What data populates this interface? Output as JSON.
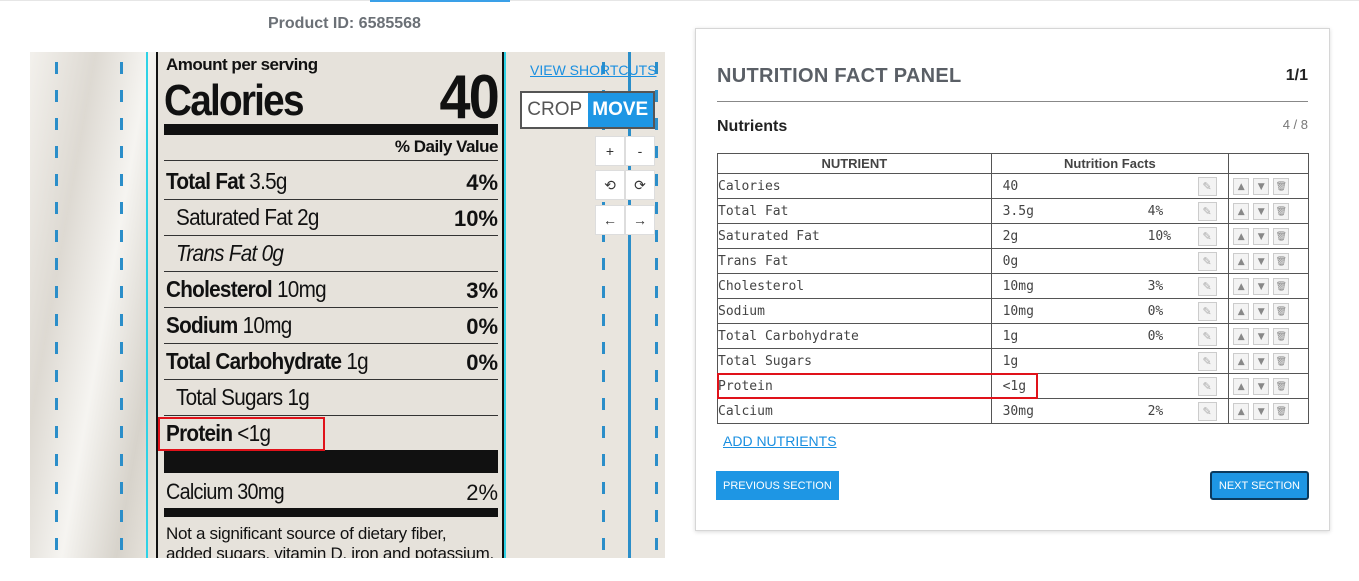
{
  "header": {
    "product_id": "Product ID: 6585568"
  },
  "label": {
    "amount": "Amount per serving",
    "calories_word": "Calories",
    "calories_value": "40",
    "daily_value_header": "% Daily Value",
    "rows": [
      {
        "bold": "Total Fat",
        "rest": " 3.5g",
        "pct": "4%"
      },
      {
        "bold": "",
        "rest": "Saturated Fat 2g",
        "pct": "10%"
      },
      {
        "bold": "",
        "rest": "Trans Fat 0g",
        "pct": ""
      },
      {
        "bold": "Cholesterol",
        "rest": " 10mg",
        "pct": "3%"
      },
      {
        "bold": "Sodium",
        "rest": " 10mg",
        "pct": "0%"
      },
      {
        "bold": "Total Carbohydrate",
        "rest": " 1g",
        "pct": "0%"
      },
      {
        "bold": "",
        "rest": "Total Sugars 1g",
        "pct": ""
      },
      {
        "bold": "Protein",
        "rest": " <1g",
        "pct": ""
      },
      {
        "bold": "",
        "rest": "Calcium 30mg",
        "pct": "2%"
      }
    ],
    "footnote_1": "Not a significant source of dietary fiber,",
    "footnote_2": "added sugars, vitamin D, iron and potassium."
  },
  "viewer": {
    "shortcuts": "VIEW SHORTCUTS",
    "crop": "CROP",
    "move": "MOVE",
    "zoom_in": "+",
    "zoom_out": "-",
    "rotate_left": "⟲",
    "rotate_right": "⟳",
    "pan_left": "←",
    "pan_right": "→"
  },
  "panel": {
    "title": "NUTRITION FACT PANEL",
    "page": "1/1",
    "section": "Nutrients",
    "section_count": "4 / 8",
    "col_nutrient": "NUTRIENT",
    "col_facts": "Nutrition Facts",
    "rows": [
      {
        "name": "Calories",
        "value": "40",
        "pct": ""
      },
      {
        "name": "Total Fat",
        "value": "3.5g",
        "pct": "4%"
      },
      {
        "name": "Saturated Fat",
        "value": "2g",
        "pct": "10%"
      },
      {
        "name": "Trans Fat",
        "value": "0g",
        "pct": ""
      },
      {
        "name": "Cholesterol",
        "value": "10mg",
        "pct": "3%"
      },
      {
        "name": "Sodium",
        "value": "10mg",
        "pct": "0%"
      },
      {
        "name": "Total Carbohydrate",
        "value": "1g",
        "pct": "0%"
      },
      {
        "name": "Total Sugars",
        "value": "1g",
        "pct": ""
      },
      {
        "name": "Protein",
        "value": "<1g",
        "pct": ""
      },
      {
        "name": "Calcium",
        "value": "30mg",
        "pct": "2%"
      }
    ],
    "add_nutrients": "ADD NUTRIENTS",
    "prev_section": "PREVIOUS SECTION",
    "next_section": "NEXT SECTION"
  },
  "colors": {
    "accent": "#1e96e4",
    "highlight": "#e0121a",
    "link": "#1a8fe0"
  }
}
